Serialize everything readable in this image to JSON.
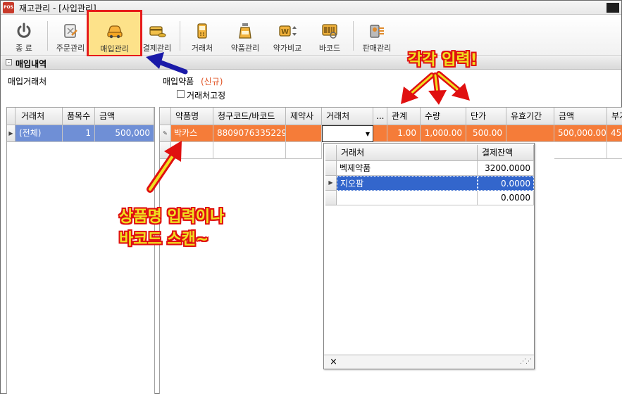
{
  "window": {
    "app_icon_text": "POS",
    "title": "재고관리 - [사입관리]"
  },
  "toolbar": {
    "exit": "종 료",
    "order_mgmt": "주문관리",
    "purchase_mgmt": "매입관리",
    "payment_mgmt": "결제관리",
    "supplier": "거래처",
    "drug_mgmt": "약품관리",
    "price_compare": "약가비교",
    "barcode": "바코드",
    "sales_mgmt": "판매관리"
  },
  "section": {
    "title": "매입내역",
    "collapse_symbol": "-"
  },
  "form": {
    "supplier_label": "매입거래처",
    "drug_label": "매입약품",
    "drug_status": "(신규)",
    "fix_supplier_label": "거래처고정"
  },
  "left_grid": {
    "headers": [
      "거래처",
      "품목수",
      "금액"
    ],
    "row": {
      "supplier": "(전체)",
      "count": "1",
      "amount": "500,000"
    }
  },
  "right_grid": {
    "headers": [
      "약품명",
      "청구코드/바코드",
      "제약사",
      "거래처",
      "...",
      "관계",
      "수량",
      "단가",
      "유효기간",
      "금액",
      "부가"
    ],
    "row": {
      "name": "박카스",
      "code": "8809076335229",
      "maker": "",
      "supplier": "",
      "relation": "1.00",
      "qty": "1,000.00",
      "unit_price": "500.00",
      "expiry": "",
      "amount": "500,000.00",
      "vat": "45"
    }
  },
  "dropdown": {
    "headers": [
      "거래처",
      "결제잔액"
    ],
    "rows": [
      {
        "name": "벡제약품",
        "balance": "3200.0000"
      },
      {
        "name": "지오팜",
        "balance": "0.0000"
      },
      {
        "name": "",
        "balance": "0.0000"
      }
    ],
    "close_symbol": "×"
  },
  "annotations": {
    "each_input": "각각 입력!",
    "line1": "상품명 입력이나",
    "line2": "바코드 스캔~"
  },
  "colors": {
    "accent_orange": "#f57c39",
    "selection_blue": "#3366cc",
    "annotation_red": "#e01010",
    "annotation_yellow": "#f0e020"
  },
  "icons": [
    "power-icon",
    "order-icon",
    "purchase-car-icon",
    "payment-card-icon",
    "supplier-phone-icon",
    "drug-bottle-icon",
    "price-compare-icon",
    "barcode-icon",
    "sales-icon"
  ]
}
